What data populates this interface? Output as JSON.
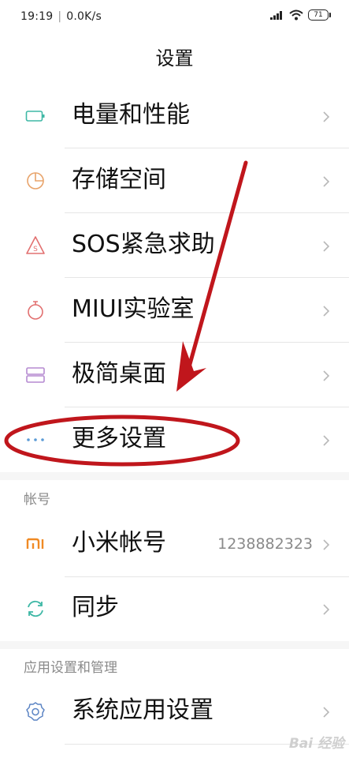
{
  "status": {
    "time": "19:19",
    "speed": "0.0K/s",
    "battery": "71"
  },
  "title": "设置",
  "items": [
    {
      "label": "电量和性能",
      "icon": "battery-icon"
    },
    {
      "label": "存储空间",
      "icon": "storage-pie-icon"
    },
    {
      "label": "SOS紧急求助",
      "icon": "sos-warning-icon"
    },
    {
      "label": "MIUI实验室",
      "icon": "flask-icon"
    },
    {
      "label": "极简桌面",
      "icon": "simple-desktop-icon"
    },
    {
      "label": "更多设置",
      "icon": "more-dots-icon"
    }
  ],
  "account_section": {
    "header": "帐号",
    "items": [
      {
        "label": "小米帐号",
        "value": "1238882323",
        "icon": "mi-logo-icon"
      },
      {
        "label": "同步",
        "icon": "sync-icon"
      }
    ]
  },
  "apps_section": {
    "header": "应用设置和管理",
    "items": [
      {
        "label": "系统应用设置",
        "icon": "gear-icon"
      }
    ]
  },
  "watermark": "Bai 经验",
  "colors": {
    "annotation": "#c0161c",
    "chevron": "#b8b8b8"
  }
}
